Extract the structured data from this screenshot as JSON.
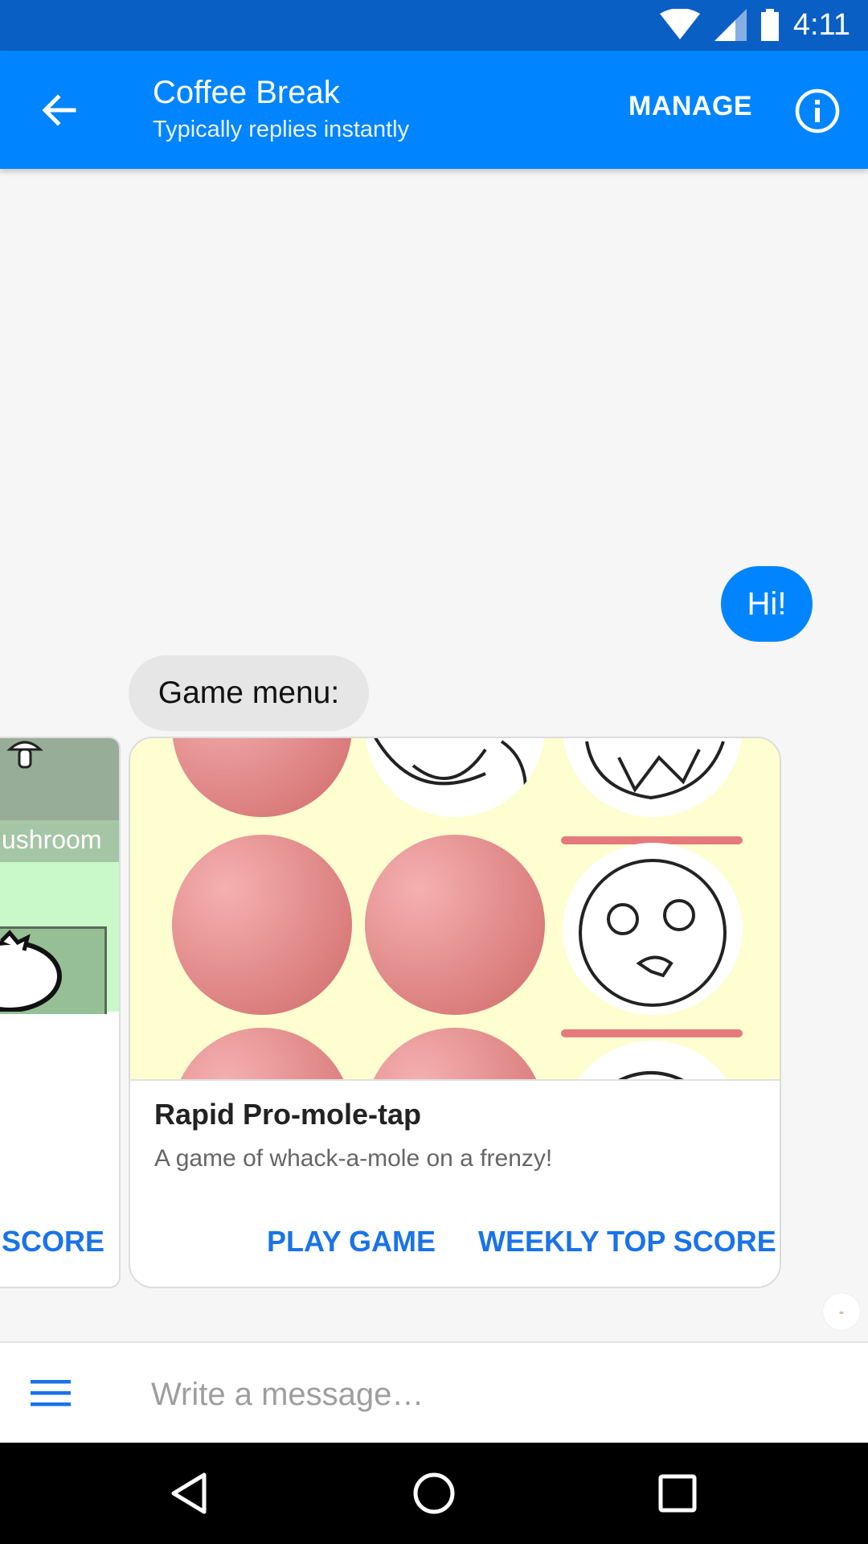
{
  "status_bar": {
    "time": "4:11"
  },
  "header": {
    "title": "Coffee Break",
    "subtitle": "Typically replies instantly",
    "manage_label": "MANAGE",
    "back_icon": "arrow-left-icon",
    "info_icon": "info-icon"
  },
  "messages": [
    {
      "sender": "user",
      "text": "Hi!"
    },
    {
      "sender": "bot",
      "text": "Game menu:"
    }
  ],
  "carousel": {
    "cards": [
      {
        "banner_text": "ushroom",
        "buttons": [
          "SCORE"
        ]
      },
      {
        "title": "Rapid Pro-mole-tap",
        "description": "A game of whack-a-mole on a frenzy!",
        "buttons": [
          "PLAY GAME",
          "WEEKLY TOP SCORE"
        ]
      }
    ]
  },
  "composer": {
    "placeholder": "Write a message…",
    "menu_icon": "hamburger-menu-icon"
  },
  "colors": {
    "status_bar": "#0a5fc4",
    "app_bar": "#0084ff",
    "accent": "#1a73e8",
    "bot_bubble": "#e6e6e6"
  }
}
